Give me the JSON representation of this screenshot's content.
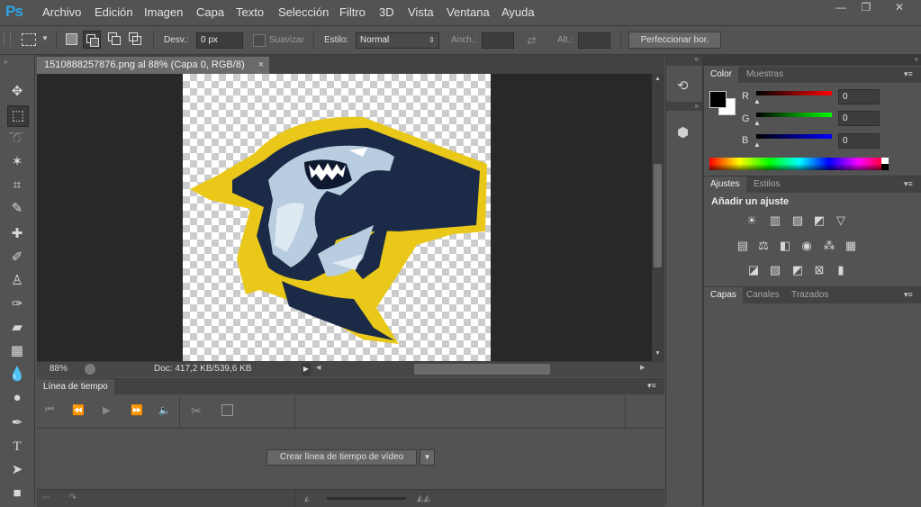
{
  "app": {
    "logo": "Ps"
  },
  "menu": [
    "Archivo",
    "Edición",
    "Imagen",
    "Capa",
    "Texto",
    "Selección",
    "Filtro",
    "3D",
    "Vista",
    "Ventana",
    "Ayuda"
  ],
  "window_controls": {
    "minimize": "—",
    "restore": "❐",
    "close": "✕"
  },
  "options": {
    "feather_label": "Desv.:",
    "feather_value": "0 px",
    "smooth_label": "Suavizar",
    "style_label": "Estilo:",
    "style_value": "Normal",
    "width_label": "Anch.:",
    "height_label": "Alt.:",
    "refine_button": "Perfeccionar bor."
  },
  "document": {
    "tab_title": "1510888257876.png al 88% (Capa 0, RGB/8)",
    "close_symbol": "×",
    "zoom": "88%",
    "doc_info": "Doc: 417,2 KB/539,6 KB"
  },
  "timeline": {
    "title": "Línea de tiempo",
    "create_button": "Crear línea de tiempo de vídeo"
  },
  "color_panel": {
    "tabs": [
      "Color",
      "Muestras"
    ],
    "channels": [
      {
        "label": "R",
        "value": "0",
        "color": "#ff0000"
      },
      {
        "label": "G",
        "value": "0",
        "color": "#00ff00"
      },
      {
        "label": "B",
        "value": "0",
        "color": "#0000ff"
      }
    ],
    "foreground": "#000000",
    "background": "#ffffff"
  },
  "adjust_panel": {
    "tabs": [
      "Ajustes",
      "Estilos"
    ],
    "heading": "Añadir un ajuste"
  },
  "layers_panel": {
    "tabs": [
      "Capas",
      "Canales",
      "Trazados"
    ]
  },
  "colors": {
    "accent": "#2fa3e6",
    "shark_navy": "#1b2a47",
    "shark_yellow": "#e9c81a",
    "ui_bg": "#535353"
  }
}
